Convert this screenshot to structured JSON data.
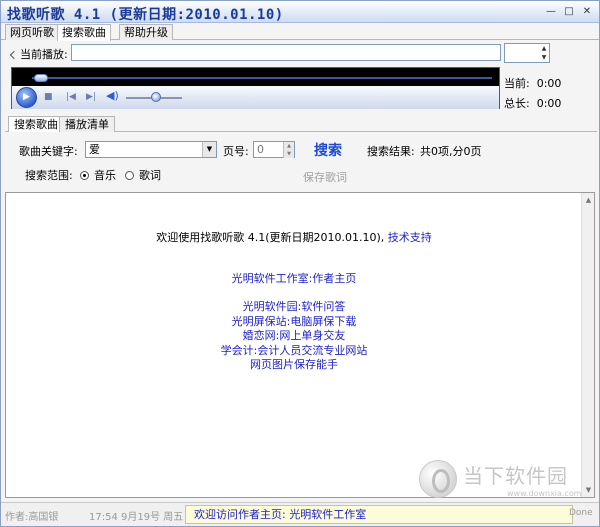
{
  "window": {
    "title": "找歌听歌 4.1 (更新日期:2010.01.10)"
  },
  "window_buttons": {
    "minimize": "—",
    "maximize": "□",
    "close": "✕"
  },
  "top_tabs": [
    "网页听歌",
    "搜索歌曲",
    "帮助升级"
  ],
  "player": {
    "now_playing_label": "当前播放:",
    "now_playing_value": "",
    "current_label": "当前:",
    "current_time": "0:00",
    "total_label": "总长:",
    "total_time": "0:00",
    "seek_fraction": 0.0,
    "volume_fraction": 0.55
  },
  "sub_tabs": [
    "搜索歌曲",
    "播放清单"
  ],
  "search": {
    "keyword_label": "歌曲关键字:",
    "keyword_value": "爱",
    "page_label": "页号:",
    "page_value": "0",
    "search_button": "搜索",
    "results_label": "搜索结果:",
    "results_value": "共0项,分0页",
    "scope_label": "搜索范围:",
    "scope_options": [
      "音乐",
      "歌词"
    ],
    "scope_selected": "音乐",
    "save_lyrics": "保存歌词"
  },
  "content": {
    "welcome_text": "欢迎使用找歌听歌 4.1(更新日期2010.01.10),",
    "support_link": "技术支持",
    "author_link": "光明软件工作室:作者主页",
    "links": [
      "光明软件园:软件问答",
      "光明屏保站:电脑屏保下载",
      "婚恋网:网上单身交友",
      "学会计:会计人员交流专业网站",
      "网页图片保存能手"
    ]
  },
  "watermark": {
    "text": "当下软件园",
    "url": "www.downxia.com"
  },
  "statusbar": {
    "author": "作者:高国银",
    "time": "17:54 9月19号 周五",
    "link": "欢迎访问作者主页: 光明软件工作室",
    "done": "Done"
  }
}
